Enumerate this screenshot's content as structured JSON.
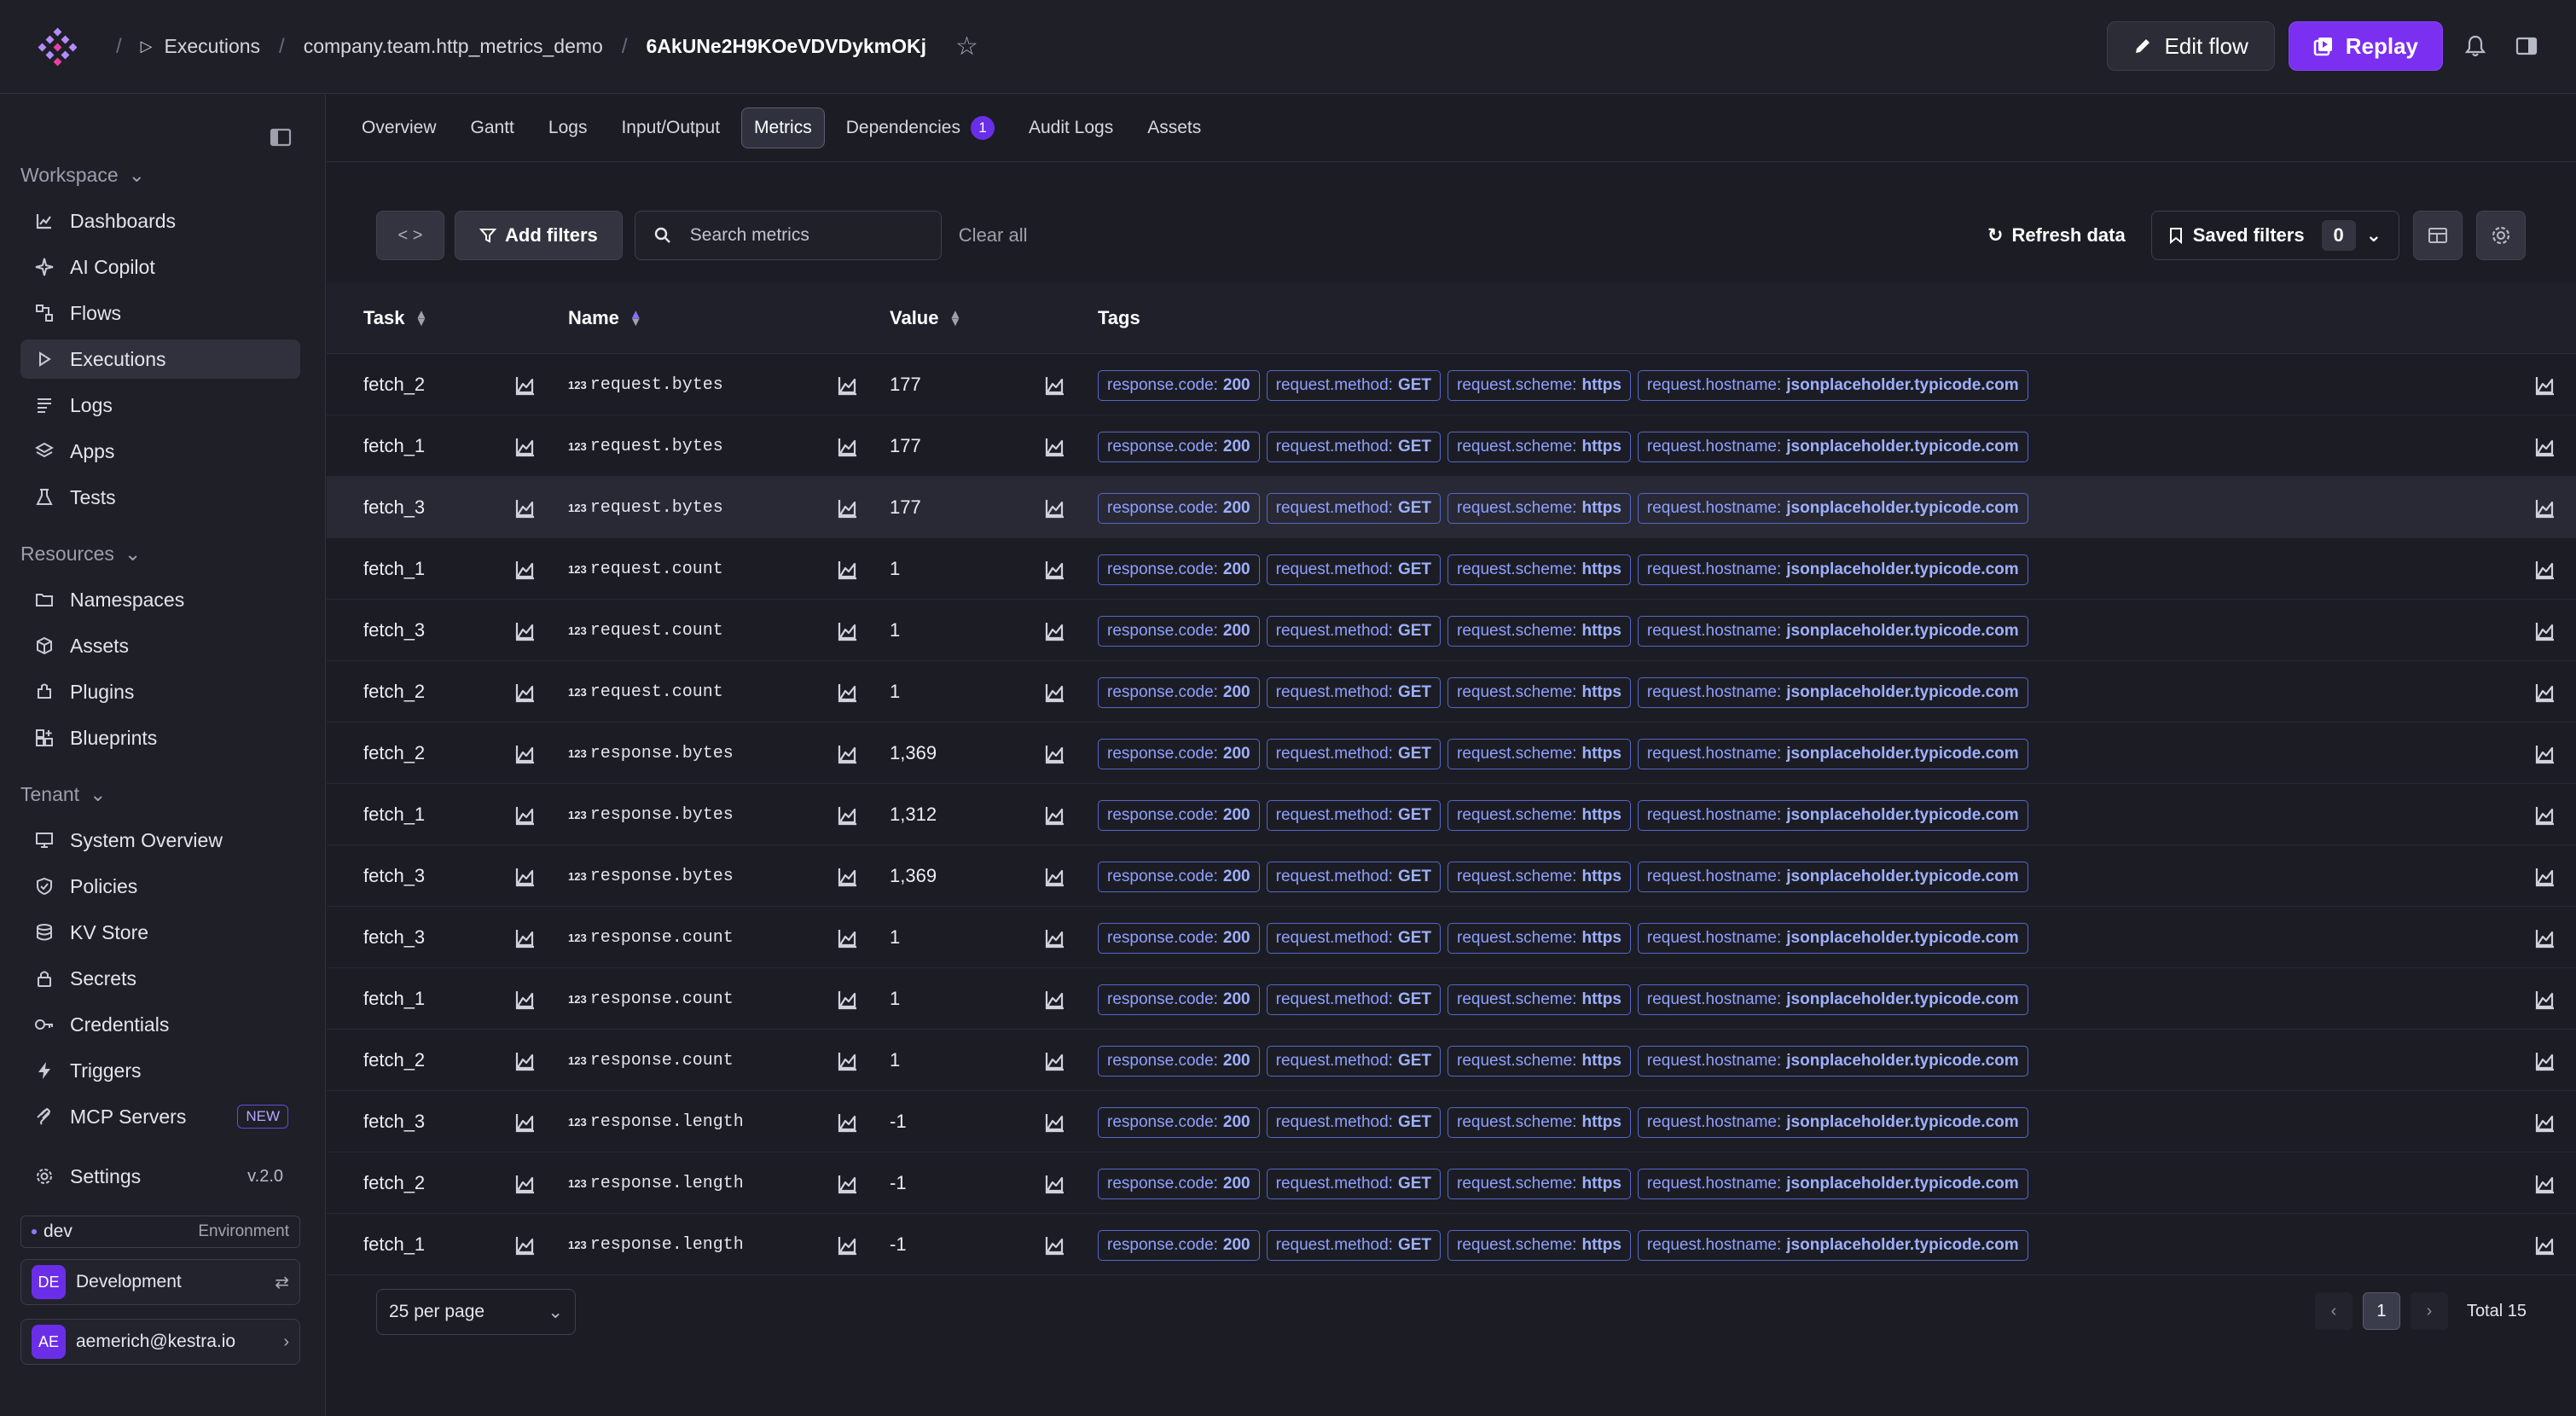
{
  "topbar": {
    "breadcrumb": [
      "Executions",
      "company.team.http_metrics_demo",
      "6AkUNe2H9KOeVDVDykmOKj"
    ],
    "edit_label": "Edit flow",
    "replay_label": "Replay"
  },
  "sidebar": {
    "workspace_label": "Workspace",
    "workspace_items": [
      "Dashboards",
      "AI Copilot",
      "Flows",
      "Executions",
      "Logs",
      "Apps",
      "Tests"
    ],
    "resources_label": "Resources",
    "resources_items": [
      "Namespaces",
      "Assets",
      "Plugins",
      "Blueprints"
    ],
    "tenant_label": "Tenant",
    "tenant_items": [
      "System Overview",
      "Policies",
      "KV Store",
      "Secrets",
      "Credentials",
      "Triggers",
      "MCP Servers"
    ],
    "new_badge": "NEW",
    "settings_label": "Settings",
    "version": "v.2.0",
    "env_name": "dev",
    "env_label": "Environment",
    "tenant_avatar": "DE",
    "tenant_name": "Development",
    "user_avatar": "AE",
    "user_email": "aemerich@kestra.io"
  },
  "tabs": [
    "Overview",
    "Gantt",
    "Logs",
    "Input/Output",
    "Metrics",
    "Dependencies",
    "Audit Logs",
    "Assets"
  ],
  "dependencies_count": "1",
  "filters": {
    "add_label": "Add filters",
    "search_placeholder": "Search metrics",
    "clear_label": "Clear all",
    "refresh_label": "Refresh data",
    "saved_label": "Saved filters",
    "saved_count": "0"
  },
  "table": {
    "columns": [
      "Task",
      "Name",
      "Value",
      "Tags"
    ],
    "number_marker": "123",
    "tag_labels": [
      "response.code:",
      "request.method:",
      "request.scheme:",
      "request.hostname:"
    ],
    "tag_values": [
      "200",
      "GET",
      "https",
      "jsonplaceholder.typicode.com"
    ],
    "rows": [
      {
        "task": "fetch_2",
        "name": "request.bytes",
        "value": "177"
      },
      {
        "task": "fetch_1",
        "name": "request.bytes",
        "value": "177"
      },
      {
        "task": "fetch_3",
        "name": "request.bytes",
        "value": "177"
      },
      {
        "task": "fetch_1",
        "name": "request.count",
        "value": "1"
      },
      {
        "task": "fetch_3",
        "name": "request.count",
        "value": "1"
      },
      {
        "task": "fetch_2",
        "name": "request.count",
        "value": "1"
      },
      {
        "task": "fetch_2",
        "name": "response.bytes",
        "value": "1,369"
      },
      {
        "task": "fetch_1",
        "name": "response.bytes",
        "value": "1,312"
      },
      {
        "task": "fetch_3",
        "name": "response.bytes",
        "value": "1,369"
      },
      {
        "task": "fetch_3",
        "name": "response.count",
        "value": "1"
      },
      {
        "task": "fetch_1",
        "name": "response.count",
        "value": "1"
      },
      {
        "task": "fetch_2",
        "name": "response.count",
        "value": "1"
      },
      {
        "task": "fetch_3",
        "name": "response.length",
        "value": "-1"
      },
      {
        "task": "fetch_2",
        "name": "response.length",
        "value": "-1"
      },
      {
        "task": "fetch_1",
        "name": "response.length",
        "value": "-1"
      }
    ]
  },
  "pagination": {
    "per_page": "25 per page",
    "current_page": "1",
    "total": "Total 15"
  }
}
